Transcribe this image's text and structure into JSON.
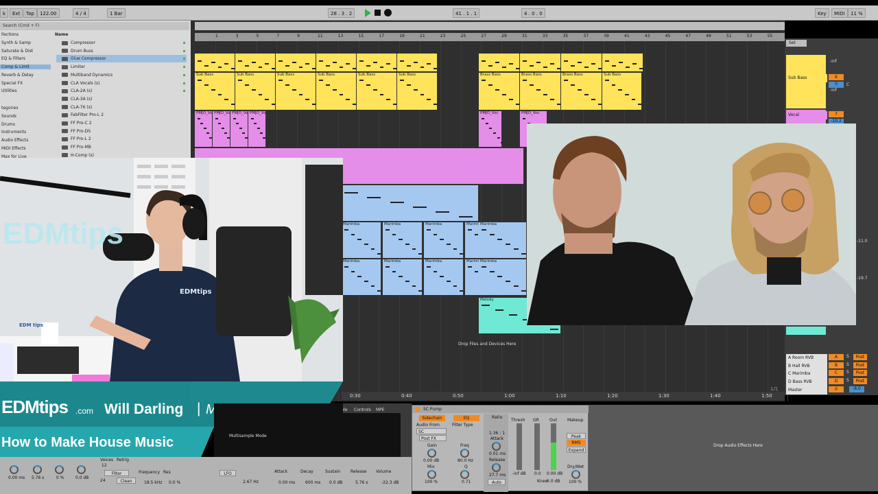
{
  "transport": {
    "tap": "Tap",
    "tempo": "122.00",
    "signature": "4 / 4",
    "quant": "1 Bar",
    "position": "28 . 3 . 2",
    "loop_start": "41 . 1 . 1",
    "loop_len": "4 . 0 . 0",
    "key": "Key",
    "midi": "MIDI",
    "cpu": "11 %",
    "h": "H",
    "w": "W",
    "ext": "Ext"
  },
  "browser": {
    "search": "Search (Cmd + F)",
    "name_header": "Name",
    "collections_header": "llections",
    "categories_header": "tegories",
    "collections": [
      "Synth & Samp",
      "Saturate & Dist",
      "EQ & Filters",
      "Comp & Limit",
      "Reverb & Delay",
      "Special FX",
      "Utilities"
    ],
    "categories": [
      "Sounds",
      "Drums",
      "Instruments",
      "Audio Effects",
      "MIDI Effects",
      "Max for Live"
    ],
    "items": [
      "Compressor",
      "Drum Buss",
      "Glue Compressor",
      "Limiter",
      "Multiband Dynamics",
      "CLA Vocals (s)",
      "CLA-2A (s)",
      "CLA-3A (s)",
      "CLA-76 (s)",
      "FabFilter Pro-L 2",
      "FF Pro-C 2",
      "FF Pro-DS",
      "FF Pro-L 2",
      "FF Pro-MB",
      "H-Comp (s)"
    ]
  },
  "ruler": [
    "1",
    "3",
    "5",
    "7",
    "9",
    "11",
    "13",
    "15",
    "17",
    "19",
    "21",
    "23",
    "25",
    "27",
    "29",
    "31",
    "33",
    "35",
    "37",
    "39",
    "41",
    "43",
    "45",
    "47",
    "49",
    "51",
    "53",
    "55",
    "57"
  ],
  "clips": {
    "sub_bass": "Sub Bass",
    "brass_bass": "Brass Bass",
    "vocal": "PMJO_Voc",
    "marimba": "Marimba",
    "melody": "Melody"
  },
  "drop_files": "Drop Files and Devices Here",
  "time_labels": [
    "0:30",
    "0:40",
    "0:50",
    "1:00",
    "1:10",
    "1:20",
    "1:30",
    "1:40",
    "1:50"
  ],
  "page_indicator": "1/1",
  "mixer": {
    "set": "Set",
    "tracks": [
      {
        "name": "Sub Bass",
        "num": "6",
        "vol": "0"
      },
      {
        "name": "Vocal",
        "num": "7",
        "vol": "-10.2"
      }
    ],
    "inf": "-inf",
    "c": "C",
    "values": [
      "-11.0",
      "-19.7",
      "-6.0"
    ],
    "returns": [
      {
        "name": "A Room RVB",
        "letter": "A"
      },
      {
        "name": "B Hall RVB",
        "letter": "B"
      },
      {
        "name": "C Marimba",
        "letter": "C"
      },
      {
        "name": "D Bass RVB",
        "letter": "D"
      },
      {
        "name": "Master",
        "letter": "0"
      }
    ],
    "s": "S",
    "post": "Post"
  },
  "overlay": {
    "brand": "EDMtips",
    "brand_suffix": ".com",
    "presenter": "Will Darling",
    "divider": "|",
    "role": "Music Producer",
    "title": "How to Make House Music",
    "wall_logo": "EDMtips",
    "shirt_logo": "EDMtips",
    "mug_logo": "EDM tips"
  },
  "sampler": {
    "tabs": [
      "Sample",
      "Controls",
      "MPE"
    ],
    "mode": "Multisample Mode",
    "voices": "Voices",
    "retrig": "Retrig",
    "voices_val": "12",
    "filter": "Filter",
    "frequency": "Frequency",
    "res": "Res",
    "freq_val": "18.5 kHz",
    "res_val": "0.0 %",
    "clean": "Clean",
    "lfo": "LFO",
    "lfo_rate": "2.67 Hz",
    "attack": "Attack",
    "decay": "Decay",
    "sustain": "Sustain",
    "release": "Release",
    "volume": "Volume",
    "attack_val": "0.00 ms",
    "decay_val": "600 ms",
    "sustain_val": "0.0 dB",
    "release_val": "5.76 s",
    "volume_val": "-22.3 dB",
    "k1": "0.00 ms",
    "k2": "5.76 s",
    "k3": "0 %",
    "k4": "0.0 dB",
    "num24": "24"
  },
  "sc_pump": {
    "title": "SC Pump",
    "sidechain": "Sidechain",
    "eq": "EQ",
    "audio_from": "Audio From",
    "audio_from_val": "SC",
    "post_fx": "Post FX",
    "filter_type": "Filter Type",
    "gain": "Gain",
    "gain_val": "0.00 dB",
    "mix": "Mix",
    "mix_val": "100 %",
    "freq": "Freq",
    "freq_val": "80.0 Hz",
    "q": "Q",
    "q_val": "0.71",
    "ratio": "Ratio",
    "ratio_val": "1.36 : 1",
    "attack": "Attack",
    "attack_val": "0.01 ms",
    "release": "Release",
    "release_val": "27.7 ms",
    "auto": "Auto",
    "thresh": "Thresh",
    "gr": "GR",
    "out": "Out",
    "thresh_val": "-inf dB",
    "gr_val": "0.0",
    "out_val": "0.00 dB",
    "knee": "Knee",
    "knee_val": "6.0 dB",
    "makeup": "Makeup",
    "peak": "Peak",
    "rms": "RMS",
    "expand": "Expand",
    "drywet": "Dry/Wet",
    "drywet_val": "100 %"
  },
  "fx_drop": "Drop Audio Effects Here",
  "colors": {
    "yellow": "#ffe35a",
    "pink": "#e48ee9",
    "blue": "#a5c8f0",
    "cyan": "#6fe8d4",
    "orange": "#f08a24",
    "teal": "#1e8f95"
  }
}
